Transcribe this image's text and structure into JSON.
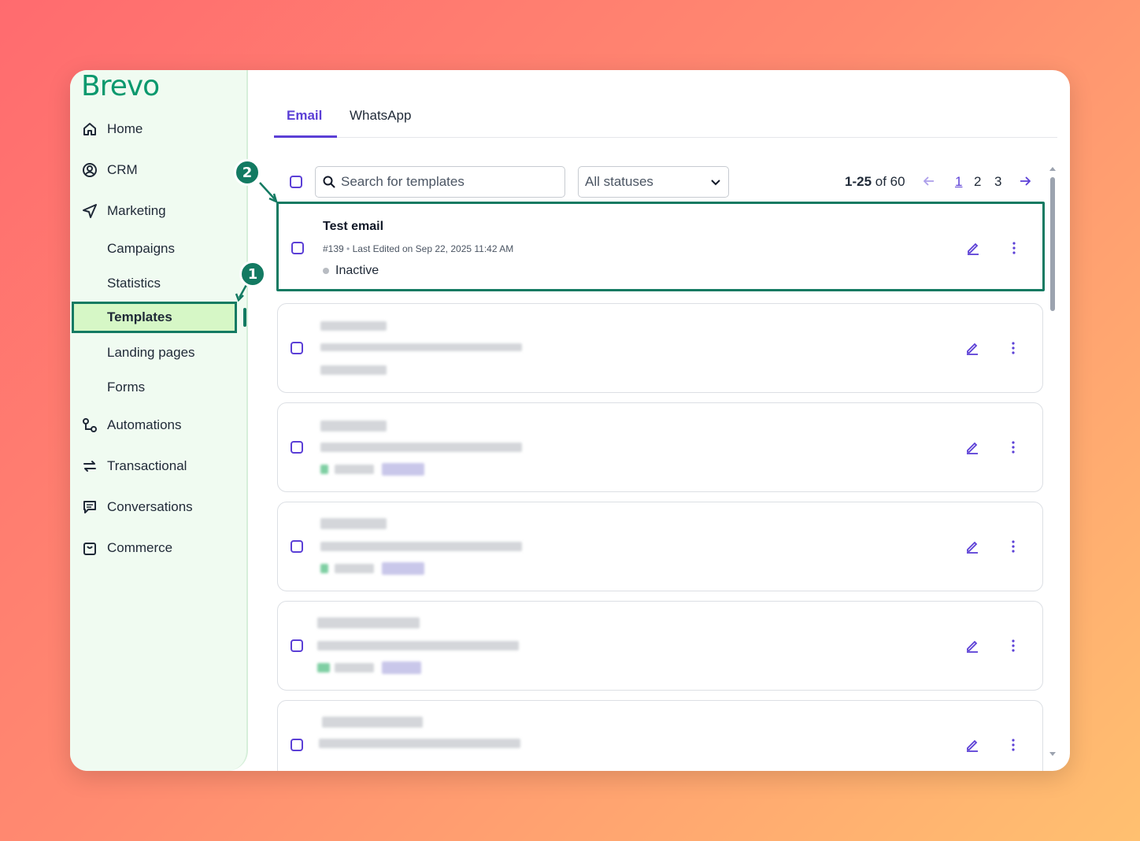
{
  "brand": {
    "logo": "Brevo",
    "accent": "#137a62",
    "primary": "#5b3fd6"
  },
  "sidebar": {
    "items": [
      {
        "label": "Home",
        "icon": "home-icon"
      },
      {
        "label": "CRM",
        "icon": "contacts-icon"
      },
      {
        "label": "Marketing",
        "icon": "send-icon"
      },
      {
        "label": "Campaigns"
      },
      {
        "label": "Statistics"
      },
      {
        "label": "Templates"
      },
      {
        "label": "Landing pages"
      },
      {
        "label": "Forms"
      },
      {
        "label": "Automations",
        "icon": "automation-icon"
      },
      {
        "label": "Transactional",
        "icon": "transfer-icon"
      },
      {
        "label": "Conversations",
        "icon": "chat-icon"
      },
      {
        "label": "Commerce",
        "icon": "bag-icon"
      }
    ]
  },
  "tabs": [
    {
      "label": "Email"
    },
    {
      "label": "WhatsApp"
    }
  ],
  "toolbar": {
    "search_placeholder": "Search for templates",
    "status_select": "All statuses",
    "range": "1-25",
    "of_total": "of 60",
    "pages": [
      "1",
      "2",
      "3"
    ]
  },
  "templates": [
    {
      "title": "Test email",
      "id": "#139",
      "meta": "Last Edited on Sep 22, 2025 11:42 AM",
      "status": "Inactive"
    }
  ],
  "callouts": [
    "1",
    "2"
  ]
}
